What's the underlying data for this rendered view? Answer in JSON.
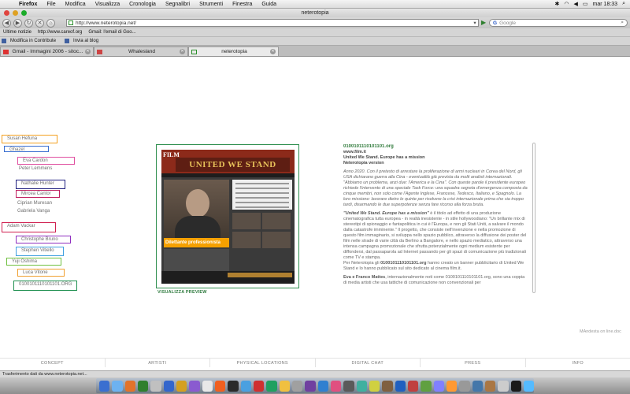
{
  "menubar": {
    "app": "Firefox",
    "items": [
      "File",
      "Modifica",
      "Visualizza",
      "Cronologia",
      "Segnalibri",
      "Strumenti",
      "Finestra",
      "Guida"
    ],
    "clock": "mar 18:33"
  },
  "window": {
    "title": "neterotopia"
  },
  "nav": {
    "url": "http://www.neterotopia.net/",
    "search_placeholder": "Google"
  },
  "bookmarks": {
    "row1": [
      "Ultime notizie",
      "http://www.careof.org",
      "Gmail: l'email di Goo..."
    ],
    "row2": [
      "Modifica in Contribute",
      "Invia al blog"
    ]
  },
  "tabs": [
    {
      "title": "Gmail - Immagini 2006 - sitoc...",
      "active": false
    },
    {
      "title": "Whalesland",
      "active": false
    },
    {
      "title": "neterotopia",
      "active": true
    }
  ],
  "people": [
    {
      "label": "Susan Hefuna",
      "color": "#f4a020"
    },
    {
      "label": "Ghazel",
      "color": "#3a6fd0"
    },
    {
      "label": "Eva Cardon",
      "color": "#e050a0"
    },
    {
      "label": "Peter Lemmens",
      "color": ""
    },
    {
      "label": "Nathalie Hunter",
      "color": "#202080"
    },
    {
      "label": "Mircea Cantor",
      "color": "#c02060"
    },
    {
      "label": "Ciprian Muresan",
      "color": ""
    },
    {
      "label": "Gabriela Vanga",
      "color": ""
    },
    {
      "label": "Adam Vackar",
      "color": "#d02050"
    },
    {
      "label": "Christophe Bruno",
      "color": "#9030c0"
    },
    {
      "label": "Stephen Vitiello",
      "color": "#40a0e0"
    },
    {
      "label": "Yuji Oshima",
      "color": "#70c040"
    },
    {
      "label": "Luca Vitone",
      "color": "#f0a030"
    },
    {
      "label": "0100101110101101.ORG",
      "color": "#209050"
    }
  ],
  "preview": {
    "logo": "FILM",
    "banner": "UNITED WE STAND",
    "caption": "Dilettante professionista",
    "label": "VISUALIZZA PREVIEW"
  },
  "article": {
    "h1": "0100101110101101.org",
    "sub1": "www.film.it",
    "sub2": "United We Stand. Europe has a mission",
    "sub3": "Neterotopia version",
    "p1": "Anno 2020. Con il pretesto di arrestare la proliferazione di armi nucleari in Corea del Nord, gli USA dichiarano guerra alla Cina - eventualità già prevista da molti analisti internazionali.",
    "p1b": "\"Abbiamo un problema, anzi due: l'America e la Cina\". Con queste parole il presidente europeo richiede l'intervento di una speciale Task Force: una squadra segreta d'emergenza composta da cinque membri, non solo come l'Agente Inglese, Francese, Tedesco, Italiano, e Spagnolo. La loro missione: lavorare dietro le quinte per risolvere la crisi internazionale prima che sia troppo tardi, disarmando le due superpotenze senza fare ricorso alla forza bruta.",
    "p2_lead": "\"United We Stand. Europe has a mission\"",
    "p2": " è il titolo ad effetto di una produzione cinematografica tutta europea - in realtà inesistente - in stile hollywoodiano: \"Un brillante mix di stereotipi di spionaggio e fantapolitica in cui è l'Europa, e non gli Stati Uniti, a salvare il mondo dalla catastrofe imminente.\" Il progetto, che consiste nell'invenzione e nella promozione di questo film immaginario, si sviluppa nello spazio pubblico, attraverso la diffusione dei poster del film nelle strade di varie città da Berlino a Bangalore, e nello spazio mediatico, attraverso una intensa campagna promozionale che sfrutta potenzialmente ogni medium esistente per diffondersi, dal passaparola ad Internet passando per gli spazi di comunicazione più tradizionali come TV e stampa.",
    "p3a": "Per Neterotopia gli ",
    "p3_org": "0100101110101101.org",
    "p3b": " hanno creato un banner pubblicitario di United We Stand e lo hanno pubblicato sul sito dedicato al cinema film.it.",
    "p4_lead": "Eva e Franco Mattes",
    "p4": ", internazionalmente noti come 0100101110101101.org, sono una coppia di media artisti che usa tattiche di comunicazione non convenzionali per"
  },
  "watermark": "MAndesta on line.doc",
  "footer": [
    "CONCEPT",
    "ARTISTI",
    "PHYSICAL LOCATIONS",
    "DIGITAL CHAT",
    "PRESS",
    "INFO"
  ],
  "status": "Trasferimento dati da www.neterotopia.net..."
}
